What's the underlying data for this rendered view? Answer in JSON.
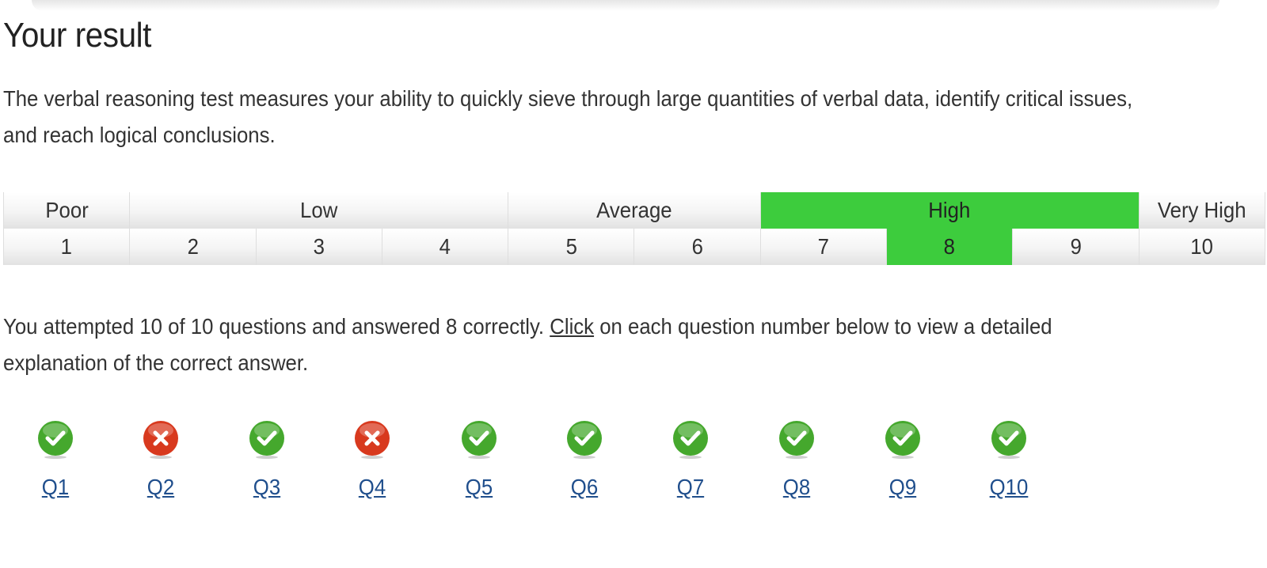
{
  "page": {
    "title": "Your result",
    "intro": "The verbal reasoning test measures your ability to quickly sieve through large quantities of verbal data, identify critical issues, and reach logical conclusions."
  },
  "score_scale": {
    "bands": [
      {
        "label": "Poor",
        "span": 1,
        "active": false
      },
      {
        "label": "Low",
        "span": 3,
        "active": false
      },
      {
        "label": "Average",
        "span": 2,
        "active": false
      },
      {
        "label": "High",
        "span": 3,
        "active": true
      },
      {
        "label": "Very High",
        "span": 1,
        "active": false
      }
    ],
    "scores": [
      "1",
      "2",
      "3",
      "4",
      "5",
      "6",
      "7",
      "8",
      "9",
      "10"
    ],
    "selected_score": "8",
    "active_color": "#3dcc3d"
  },
  "summary": {
    "before_link": "You attempted 10 of 10 questions and answered 8 correctly. ",
    "link_text": "Click",
    "after_link": " on each question number below to view a detailed explanation of the correct answer."
  },
  "questions": [
    {
      "label": "Q1",
      "status": "correct",
      "icon": "check-icon"
    },
    {
      "label": "Q2",
      "status": "incorrect",
      "icon": "cross-icon"
    },
    {
      "label": "Q3",
      "status": "correct",
      "icon": "check-icon"
    },
    {
      "label": "Q4",
      "status": "incorrect",
      "icon": "cross-icon"
    },
    {
      "label": "Q5",
      "status": "correct",
      "icon": "check-icon"
    },
    {
      "label": "Q6",
      "status": "correct",
      "icon": "check-icon"
    },
    {
      "label": "Q7",
      "status": "correct",
      "icon": "check-icon"
    },
    {
      "label": "Q8",
      "status": "correct",
      "icon": "check-icon"
    },
    {
      "label": "Q9",
      "status": "correct",
      "icon": "check-icon"
    },
    {
      "label": "Q10",
      "status": "correct",
      "icon": "check-icon"
    }
  ],
  "colors": {
    "correct": "#45a82d",
    "incorrect": "#d8391e",
    "link": "#1f4e8c"
  }
}
